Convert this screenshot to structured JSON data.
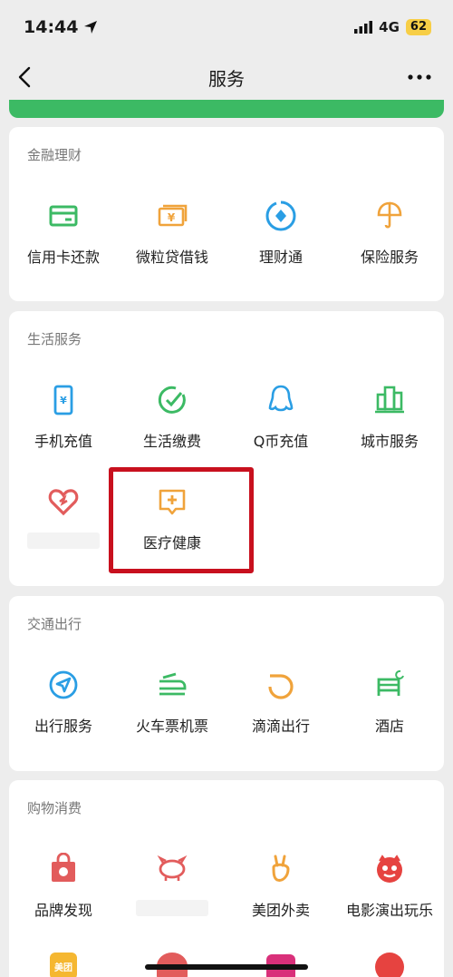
{
  "status_bar": {
    "time": "14:44",
    "network": "4G",
    "battery": "62"
  },
  "nav": {
    "title": "服务"
  },
  "sections": {
    "finance": {
      "title": "金融理财",
      "items": [
        "信用卡还款",
        "微粒贷借钱",
        "理财通",
        "保险服务"
      ]
    },
    "life": {
      "title": "生活服务",
      "items": [
        "手机充值",
        "生活缴费",
        "Q币充值",
        "城市服务",
        "医疗健康"
      ]
    },
    "transport": {
      "title": "交通出行",
      "items": [
        "出行服务",
        "火车票机票",
        "滴滴出行",
        "酒店"
      ]
    },
    "shopping": {
      "title": "购物消费",
      "items": [
        "品牌发现",
        "美团外卖",
        "电影演出玩乐"
      ],
      "partial_icon_text": "美团"
    }
  },
  "colors": {
    "green": "#3cba64",
    "blue": "#2a9ee4",
    "orange": "#f0a33b",
    "red": "#e25c5c",
    "highlight": "#c8101e"
  }
}
